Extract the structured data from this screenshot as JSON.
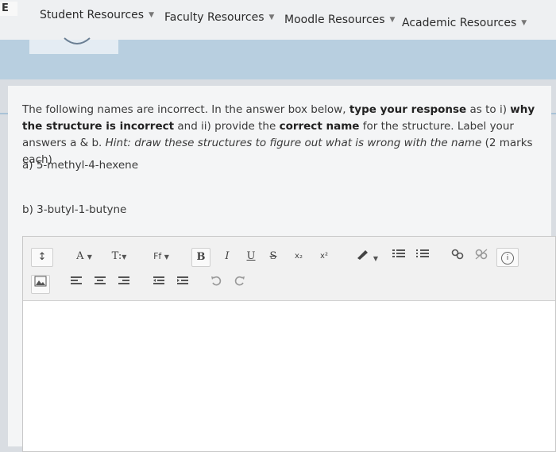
{
  "nav": {
    "logo_fragment": "E",
    "items": [
      {
        "label": "Student Resources"
      },
      {
        "label": "Faculty Resources"
      },
      {
        "label": "Moodle Resources"
      },
      {
        "label": "Academic Resources"
      }
    ]
  },
  "question": {
    "s1": "The following names are incorrect. In the answer box below, ",
    "s2": "type your response",
    "s3": " as to i) ",
    "s4": "why the structure is incorrect",
    "s5": " and ii) provide the ",
    "s6": "correct name",
    "s7": " for the structure. Label your answers a & b. ",
    "s8": "Hint: draw these structures to figure out what is wrong with the name",
    "s9": " (2 marks each)",
    "part_a": "a) 5-methyl-4-hexene",
    "part_b": "b) 3-butyl-1-butyne"
  },
  "toolbar": {
    "collapse": "↕",
    "font_color": "A",
    "text_style": "T:",
    "font_family": "Ff",
    "bold": "B",
    "italic": "I",
    "underline": "U",
    "strike": "S",
    "subscript": "x₂",
    "superscript": "x²",
    "info": "i"
  }
}
